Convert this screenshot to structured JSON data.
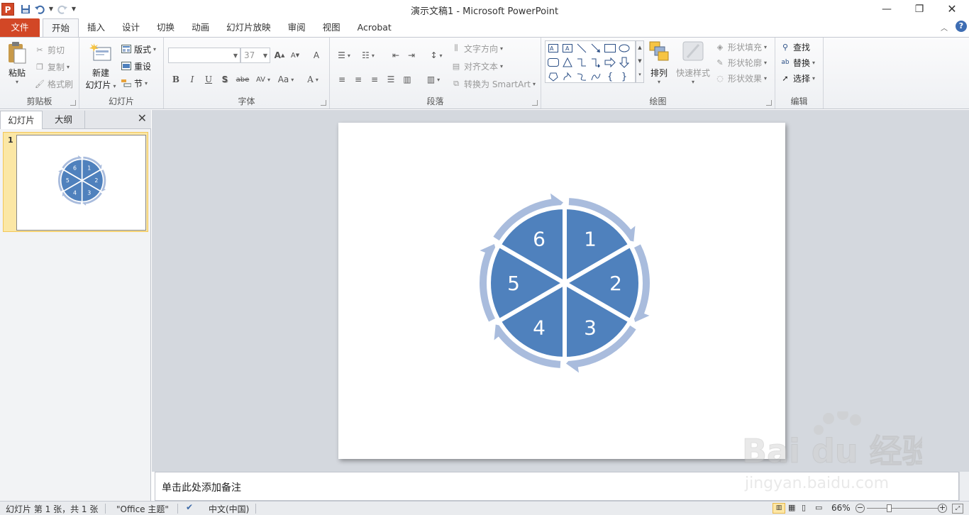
{
  "window": {
    "title": "演示文稿1  -  Microsoft PowerPoint",
    "minimize": "—",
    "restore": "❐",
    "close": "✕"
  },
  "qat": {
    "app_icon": "P",
    "save_icon": "floppy-icon",
    "undo_icon": "undo-icon",
    "redo_icon": "redo-icon"
  },
  "tabs": {
    "file": "文件",
    "items": [
      "开始",
      "插入",
      "设计",
      "切换",
      "动画",
      "幻灯片放映",
      "审阅",
      "视图",
      "Acrobat"
    ],
    "active_index": 0
  },
  "ribbon": {
    "clipboard": {
      "label": "剪贴板",
      "paste": "粘贴",
      "cut": "剪切",
      "copy": "复制",
      "format_painter": "格式刷"
    },
    "slides": {
      "label": "幻灯片",
      "new_slide_line1": "新建",
      "new_slide_line2": "幻灯片",
      "layout": "版式",
      "reset": "重设",
      "section": "节"
    },
    "font": {
      "label": "字体",
      "font_name": "",
      "font_size": "37",
      "grow": "A",
      "shrink": "A",
      "clear": "A",
      "bold": "B",
      "italic": "I",
      "underline": "U",
      "shadow": "S",
      "strike": "abe",
      "spacing": "AV",
      "case": "Aa",
      "color": "A"
    },
    "paragraph": {
      "label": "段落",
      "text_direction": "文字方向",
      "align_text": "对齐文本",
      "convert_smartart": "转换为 SmartArt"
    },
    "drawing": {
      "label": "绘图",
      "arrange": "排列",
      "quick_styles": "快速样式",
      "shape_fill": "形状填充",
      "shape_outline": "形状轮廓",
      "shape_effects": "形状效果"
    },
    "editing": {
      "label": "编辑",
      "find": "查找",
      "replace": "替换",
      "select": "选择"
    }
  },
  "panel": {
    "tab_slides": "幻灯片",
    "tab_outline": "大纲",
    "close": "✕",
    "slide_number": "1"
  },
  "slide": {
    "segments": [
      "1",
      "2",
      "3",
      "4",
      "5",
      "6"
    ],
    "fill_color": "#4f81bd",
    "arrow_color": "#a9bcdd"
  },
  "notes": {
    "placeholder": "单击此处添加备注"
  },
  "status": {
    "slide_info": "幻灯片 第 1 张，共 1 张",
    "theme": "\"Office 主题\"",
    "language": "中文(中国)",
    "zoom": "66%",
    "zoom_out": "−",
    "zoom_in": "+"
  },
  "watermark": {
    "brand": "Bai  du 经验",
    "url": "jingyan.baidu.com"
  }
}
